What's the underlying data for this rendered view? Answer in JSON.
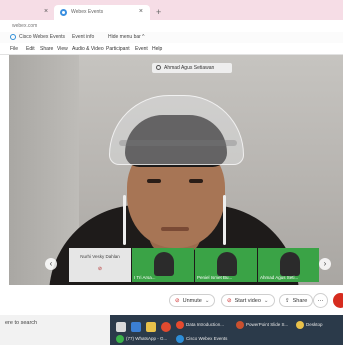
{
  "browser": {
    "active_tab_title": "Webex Events",
    "close_glyph": "×",
    "new_tab_glyph": "+",
    "address": "webex.com"
  },
  "webex_toolbar": {
    "app_name": "Cisco Webex Events",
    "event_info": "Event info",
    "hide_menu_bar": "Hide menu bar ^"
  },
  "menu": [
    "File",
    "Edit",
    "Share",
    "View",
    "Audio & Video",
    "Participant",
    "Event",
    "Help"
  ],
  "video": {
    "active_speaker": "Ahmad Agus Setiawan"
  },
  "thumbnails": [
    {
      "name": "Nurhi Vesky Dahlan",
      "style": "grey"
    },
    {
      "name": "I Tri Arsa...",
      "style": "green"
    },
    {
      "name": "Peniel Ismet Bu...",
      "style": "green"
    },
    {
      "name": "Ahmad Agus Seti...",
      "style": "green"
    }
  ],
  "controls": {
    "unmute": "Unmute",
    "start_video": "Start video",
    "share": "Share",
    "more": "..."
  },
  "taskbar": {
    "search": "ere to search",
    "apps": [
      {
        "label": "Data Introduction...",
        "color": "#e64a2e"
      },
      {
        "label": "PowerPoint Slide S...",
        "color": "#c9502f"
      },
      {
        "label": "Desktop",
        "color": "#e8c14a"
      },
      {
        "label": "(77) WhatsApp - G...",
        "color": "#3bb24a"
      },
      {
        "label": "Cisco Webex Events",
        "color": "#2d8ed8"
      }
    ]
  },
  "colors": {
    "tab_strip": "#f6dde6",
    "thumb_green": "#3aa346",
    "end_call": "#d62c1f",
    "taskbar": "#2b3a4a"
  }
}
